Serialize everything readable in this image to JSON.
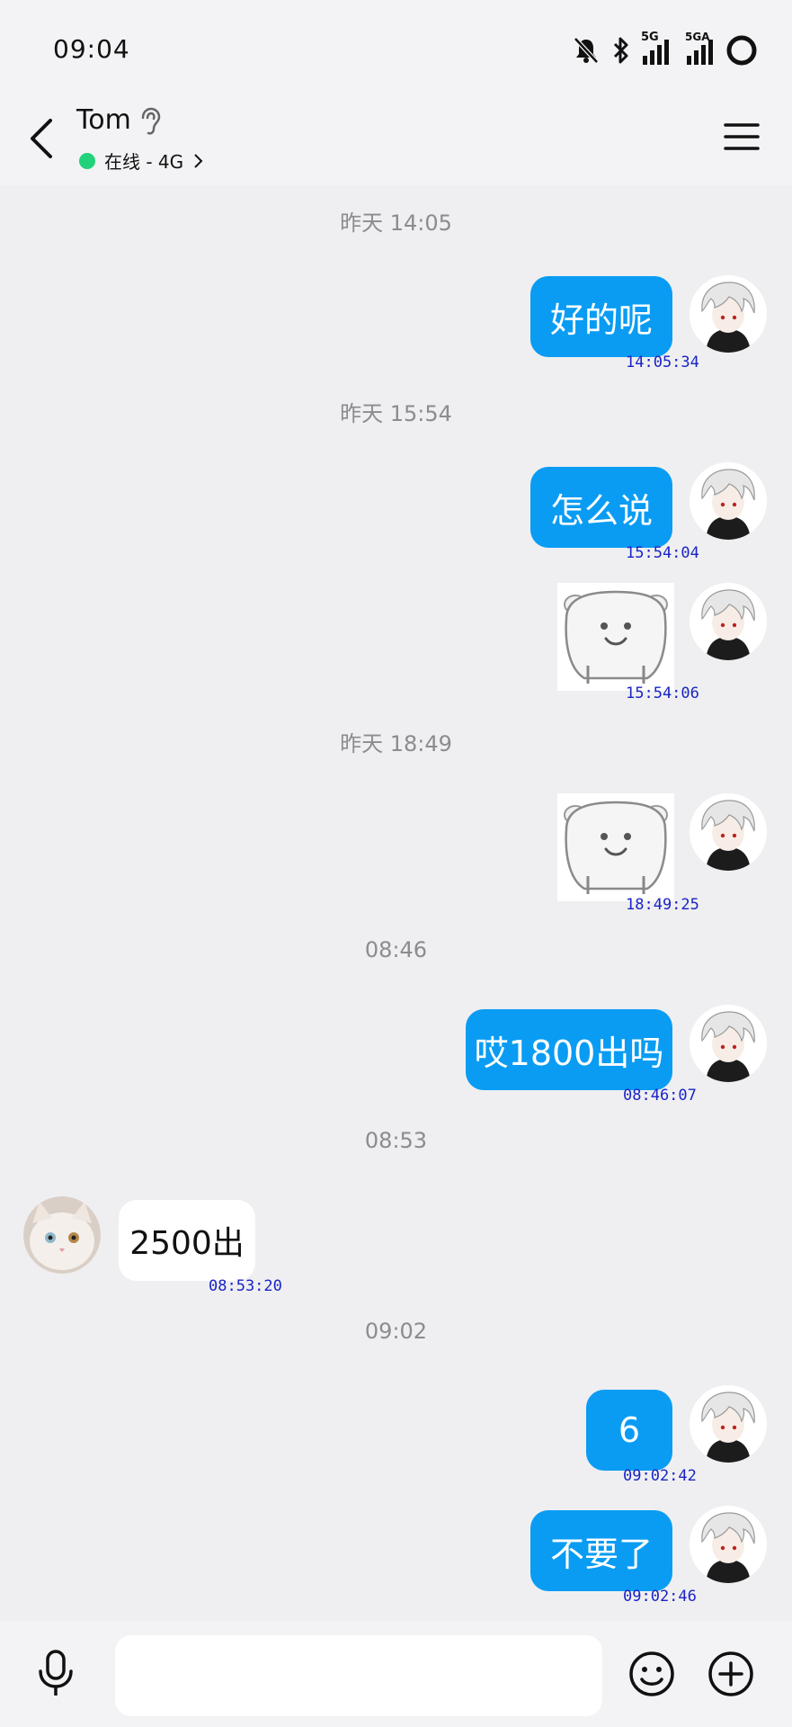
{
  "status_bar": {
    "time": "09:04",
    "icons": [
      "bell-off-icon",
      "bluetooth-icon",
      "signal-5g-icon",
      "signal-5ga-icon",
      "battery-ring-icon"
    ],
    "signal_1_label": "5G",
    "signal_2_label": "5GA"
  },
  "header": {
    "contact_name": "Tom",
    "online_status": "在线 - 4G",
    "online_color": "#22d27a"
  },
  "messages": [
    {
      "type": "timestamp",
      "text": "昨天 14:05"
    },
    {
      "type": "out_text",
      "text": "好的呢",
      "time": "14:05:34"
    },
    {
      "type": "timestamp",
      "text": "昨天 15:54"
    },
    {
      "type": "out_text",
      "text": "怎么说",
      "time": "15:54:04"
    },
    {
      "type": "out_sticker",
      "sticker": "smiling-blob-sticker",
      "time": "15:54:06"
    },
    {
      "type": "timestamp",
      "text": "昨天 18:49"
    },
    {
      "type": "out_sticker",
      "sticker": "smiling-blob-sticker",
      "time": "18:49:25"
    },
    {
      "type": "timestamp",
      "text": "08:46"
    },
    {
      "type": "out_text",
      "text": "哎1800出吗",
      "time": "08:46:07"
    },
    {
      "type": "timestamp",
      "text": "08:53"
    },
    {
      "type": "in_text",
      "text": "2500出",
      "time": "08:53:20"
    },
    {
      "type": "timestamp",
      "text": "09:02"
    },
    {
      "type": "out_text",
      "text": "6",
      "time": "09:02:42"
    },
    {
      "type": "out_text",
      "text": "不要了",
      "time": "09:02:46"
    }
  ],
  "colors": {
    "outgoing_bubble": "#0a9cf3",
    "incoming_bubble": "#ffffff",
    "message_time": "#1a24c6"
  },
  "input_bar": {
    "icons": [
      "microphone-icon",
      "emoji-icon",
      "plus-icon"
    ]
  }
}
